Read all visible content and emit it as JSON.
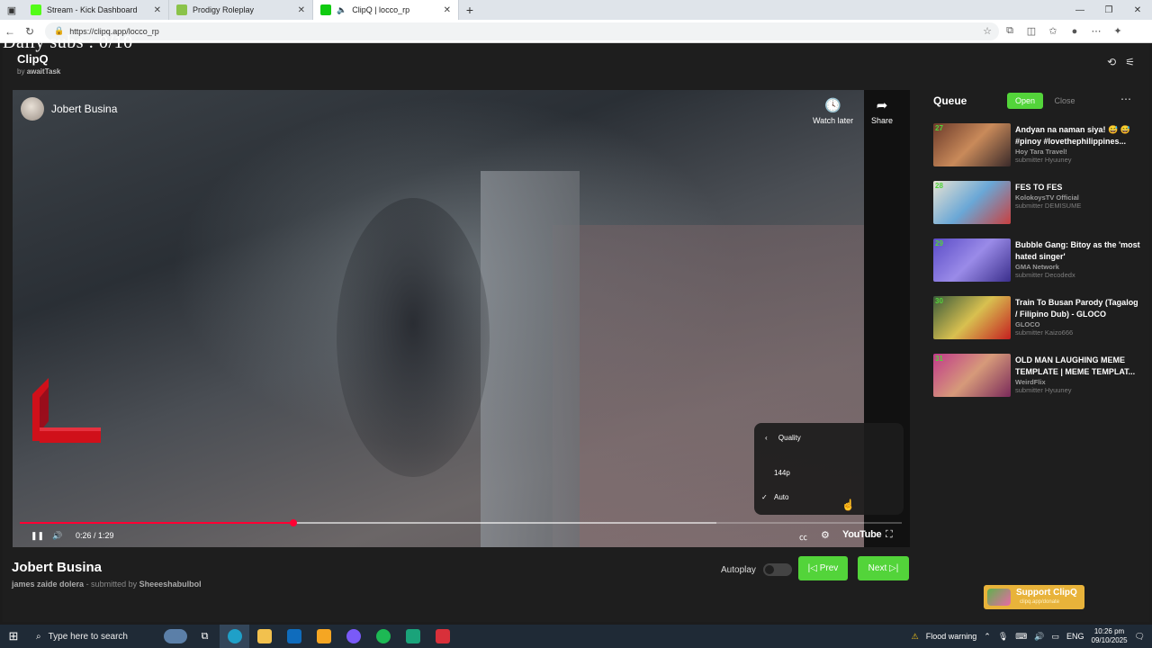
{
  "browser": {
    "tabs": [
      {
        "title": "Stream - Kick Dashboard",
        "color": "#53fc18"
      },
      {
        "title": "Prodigy Roleplay",
        "color": "#8bc34a"
      },
      {
        "title": "ClipQ | locco_rp",
        "color": "#11cc11"
      }
    ],
    "url": "https://clipq.app/locco_rp"
  },
  "overlay": {
    "daily_subs": "Daily subs : 0/10"
  },
  "app": {
    "brand": "ClipQ",
    "by_prefix": "by",
    "by_author": "awaitTask"
  },
  "player": {
    "channel": "Jobert Busina",
    "watch_later": "Watch later",
    "share": "Share",
    "quality_menu": {
      "title": "Quality",
      "options": [
        "144p",
        "Auto"
      ],
      "selected": "Auto"
    },
    "time": "0:26 / 1:29",
    "played_fraction": 0.31,
    "loaded_fraction": 0.79,
    "youtube_label": "YouTube"
  },
  "video": {
    "title": "Jobert Busina",
    "artist": "james zaide dolera",
    "submitted_prefix": "- submitted by",
    "submitter": "Sheeeshabulbol",
    "autoplay_label": "Autoplay",
    "prev_label": "|◁ Prev",
    "next_label": "Next ▷|"
  },
  "queue": {
    "title": "Queue",
    "open_label": "Open",
    "close_label": "Close",
    "items": [
      {
        "num": "27",
        "title": "Andyan na naman siya! 😅 😅 #pinoy #lovethephilippines...",
        "channel": "Hoy Tara Travel!",
        "submitter": "submitter Hyuuney"
      },
      {
        "num": "28",
        "title": "FES TO FES",
        "channel": "KolokoysTV Official",
        "submitter": "submitter DEMISUME"
      },
      {
        "num": "29",
        "title": "Bubble Gang: Bitoy as the 'most hated singer'",
        "channel": "GMA Network",
        "submitter": "submitter Decodedx"
      },
      {
        "num": "30",
        "title": "Train To Busan Parody (Tagalog / Filipino Dub) - GLOCO",
        "channel": "GLOCO",
        "submitter": "submitter Kaizo666"
      },
      {
        "num": "31",
        "title": "OLD MAN LAUGHING MEME TEMPLATE | MEME TEMPLAT...",
        "channel": "WeirdFlix",
        "submitter": "submitter Hyuuney"
      }
    ]
  },
  "support": {
    "label": "Support ClipQ",
    "sub": "clipq.app/donate"
  },
  "taskbar": {
    "search_placeholder": "Type here to search",
    "weather": "Flood warning",
    "lang": "ENG",
    "time": "10:26 pm",
    "date": "09/10/2025"
  }
}
